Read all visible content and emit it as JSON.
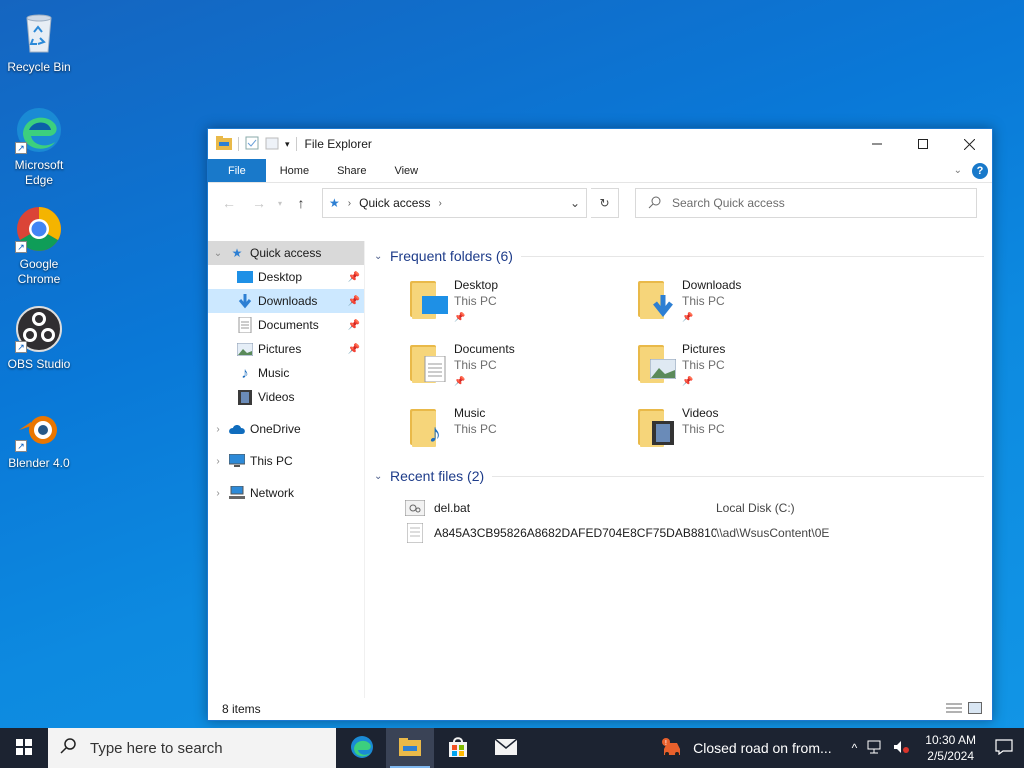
{
  "desktop": {
    "icons": [
      {
        "label": "Recycle Bin",
        "icon": "recycle-bin-icon"
      },
      {
        "label": "Microsoft Edge",
        "icon": "edge-icon"
      },
      {
        "label": "Google Chrome",
        "icon": "chrome-icon"
      },
      {
        "label": "OBS Studio",
        "icon": "obs-icon"
      },
      {
        "label": "Blender 4.0",
        "icon": "blender-icon"
      }
    ]
  },
  "window": {
    "title": "File Explorer",
    "ribbon_tabs": [
      "File",
      "Home",
      "Share",
      "View"
    ],
    "address_location": "Quick access",
    "search_placeholder": "Search Quick access",
    "nav": {
      "quick_access": "Quick access",
      "pinned": [
        {
          "label": "Desktop",
          "pinned": true
        },
        {
          "label": "Downloads",
          "pinned": true
        },
        {
          "label": "Documents",
          "pinned": true
        },
        {
          "label": "Pictures",
          "pinned": true
        },
        {
          "label": "Music",
          "pinned": false
        },
        {
          "label": "Videos",
          "pinned": false
        }
      ],
      "roots": [
        "OneDrive",
        "This PC",
        "Network"
      ]
    },
    "frequent_header": "Frequent folders (6)",
    "frequent": [
      {
        "name": "Desktop",
        "location": "This PC",
        "pinned": true
      },
      {
        "name": "Downloads",
        "location": "This PC",
        "pinned": true
      },
      {
        "name": "Documents",
        "location": "This PC",
        "pinned": true
      },
      {
        "name": "Pictures",
        "location": "This PC",
        "pinned": true
      },
      {
        "name": "Music",
        "location": "This PC",
        "pinned": false
      },
      {
        "name": "Videos",
        "location": "This PC",
        "pinned": false
      }
    ],
    "recent_header": "Recent files (2)",
    "recent": [
      {
        "name": "del.bat",
        "location": "Local Disk (C:)"
      },
      {
        "name": "A845A3CB95826A8682DAFED704E8CF75DAB8810...",
        "location": "\\\\ad\\WsusContent\\0E"
      }
    ],
    "status": "8 items"
  },
  "taskbar": {
    "search_placeholder": "Type here to search",
    "news": "Closed road on from...",
    "time": "10:30 AM",
    "date": "2/5/2024"
  },
  "colors": {
    "accent": "#1979ca",
    "folder": "#f6d57a",
    "taskbar": "#1c2331"
  }
}
